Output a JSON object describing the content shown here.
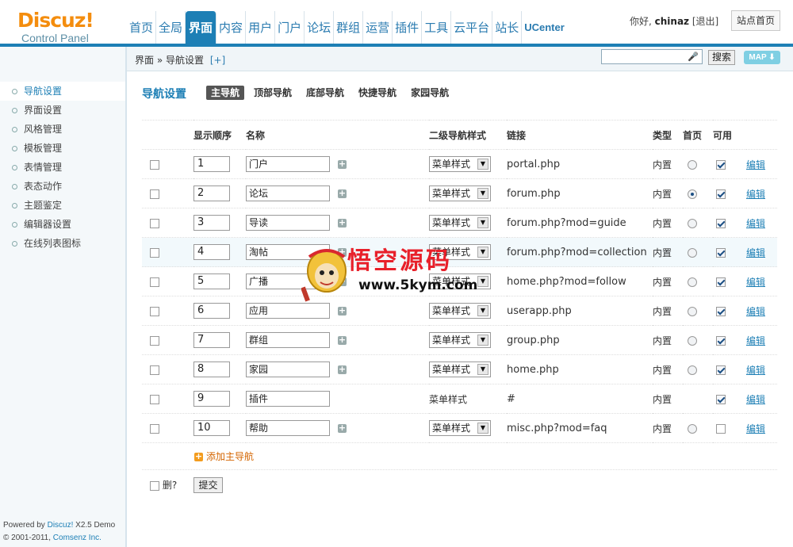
{
  "header": {
    "logo_brand": "Discuz!",
    "logo_sub": "Control Panel",
    "tabs": [
      {
        "label": "首页"
      },
      {
        "label": "全局"
      },
      {
        "label": "界面"
      },
      {
        "label": "内容"
      },
      {
        "label": "用户"
      },
      {
        "label": "门户"
      },
      {
        "label": "论坛"
      },
      {
        "label": "群组"
      },
      {
        "label": "运营"
      },
      {
        "label": "插件"
      },
      {
        "label": "工具"
      },
      {
        "label": "云平台"
      },
      {
        "label": "站长"
      },
      {
        "label": "UCenter"
      }
    ],
    "active_tab": "界面",
    "greeting": "你好, ",
    "username": "chinaz",
    "logout": "[退出]",
    "site_home": "站点首页"
  },
  "subbar": {
    "breadcrumb": "界面 » 导航设置",
    "add_shortcut": "[+]",
    "search_value": "",
    "search_button": "搜索",
    "map_button": "MAP ⬇"
  },
  "sidebar": {
    "items": [
      {
        "label": "导航设置"
      },
      {
        "label": "界面设置"
      },
      {
        "label": "风格管理"
      },
      {
        "label": "模板管理"
      },
      {
        "label": "表情管理"
      },
      {
        "label": "表态动作"
      },
      {
        "label": "主题鉴定"
      },
      {
        "label": "编辑器设置"
      },
      {
        "label": "在线列表图标"
      }
    ],
    "footer_line1_prefix": "Powered by ",
    "footer_line1_link": "Discuz!",
    "footer_line1_suffix": " X2.5 Demo",
    "footer_line2_prefix": "© 2001-2011, ",
    "footer_line2_link": "Comsenz Inc."
  },
  "main": {
    "title": "导航设置",
    "subtabs": [
      {
        "label": "主导航"
      },
      {
        "label": "顶部导航"
      },
      {
        "label": "底部导航"
      },
      {
        "label": "快捷导航"
      },
      {
        "label": "家园导航"
      }
    ],
    "columns": {
      "order": "显示顺序",
      "name": "名称",
      "style": "二级导航样式",
      "link": "链接",
      "type": "类型",
      "home": "首页",
      "enabled": "可用"
    },
    "rows": [
      {
        "order": "1",
        "name": "门户",
        "style": "菜单样式",
        "link": "portal.php",
        "type": "内置",
        "home": false,
        "enabled": true,
        "edit": "编辑"
      },
      {
        "order": "2",
        "name": "论坛",
        "style": "菜单样式",
        "link": "forum.php",
        "type": "内置",
        "home": true,
        "enabled": true,
        "edit": "编辑"
      },
      {
        "order": "3",
        "name": "导读",
        "style": "菜单样式",
        "link": "forum.php?mod=guide",
        "type": "内置",
        "home": false,
        "enabled": true,
        "edit": "编辑"
      },
      {
        "order": "4",
        "name": "淘帖",
        "style": "菜单样式",
        "link": "forum.php?mod=collection",
        "type": "内置",
        "home": false,
        "enabled": true,
        "edit": "编辑"
      },
      {
        "order": "5",
        "name": "广播",
        "style": "菜单样式",
        "link": "home.php?mod=follow",
        "type": "内置",
        "home": false,
        "enabled": true,
        "edit": "编辑"
      },
      {
        "order": "6",
        "name": "应用",
        "style": "菜单样式",
        "link": "userapp.php",
        "type": "内置",
        "home": false,
        "enabled": true,
        "edit": "编辑"
      },
      {
        "order": "7",
        "name": "群组",
        "style": "菜单样式",
        "link": "group.php",
        "type": "内置",
        "home": false,
        "enabled": true,
        "edit": "编辑"
      },
      {
        "order": "8",
        "name": "家园",
        "style": "菜单样式",
        "link": "home.php",
        "type": "内置",
        "home": false,
        "enabled": true,
        "edit": "编辑"
      },
      {
        "order": "9",
        "name": "插件",
        "style": "菜单样式",
        "link": "#",
        "type": "内置",
        "home": null,
        "enabled": true,
        "edit": "编辑",
        "plain": true
      },
      {
        "order": "10",
        "name": "帮助",
        "style": "菜单样式",
        "link": "misc.php?mod=faq",
        "type": "内置",
        "home": false,
        "enabled": false,
        "edit": "编辑"
      }
    ],
    "add_main_nav": "添加主导航",
    "delete_label": "删?",
    "submit": "提交"
  },
  "watermark": {
    "title": "悟空源码",
    "url": "www.5kym.com"
  },
  "colors": {
    "accent": "#1d7fb5",
    "logo": "#f48d0e",
    "watermark_red": "#e8202a"
  }
}
